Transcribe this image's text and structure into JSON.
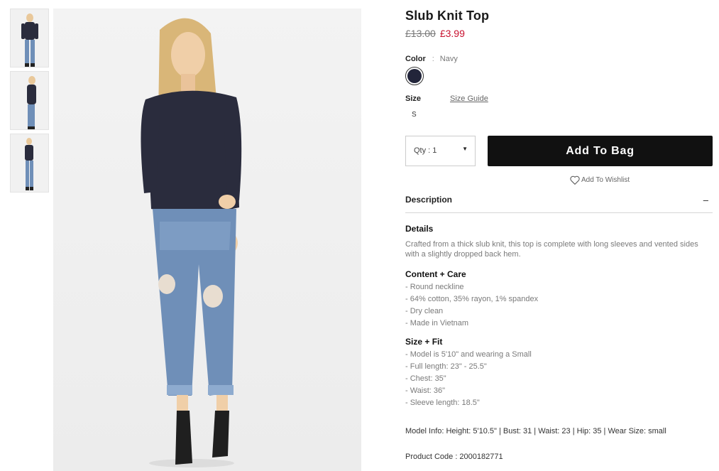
{
  "product": {
    "title": "Slub Knit Top",
    "price_original": "£13.00",
    "price_sale": "£3.99"
  },
  "color": {
    "label": "Color",
    "separator": ":",
    "value": "Navy",
    "swatch_hex": "#22253a"
  },
  "size": {
    "label": "Size",
    "guide_label": "Size Guide",
    "options": [
      "S"
    ]
  },
  "qty": {
    "label": "Qty : 1"
  },
  "actions": {
    "add_to_bag": "Add To Bag",
    "wishlist": "Add To Wishlist"
  },
  "description": {
    "header": "Description",
    "toggle": "–",
    "details_title": "Details",
    "details_text": "Crafted from a thick slub knit, this top is complete with long sleeves and vented sides with a slightly dropped back hem.",
    "content_title": "Content + Care",
    "content_items": [
      "- Round neckline",
      "- 64% cotton, 35% rayon, 1% spandex",
      "- Dry clean",
      "- Made in Vietnam"
    ],
    "fit_title": "Size + Fit",
    "fit_items": [
      "- Model is 5'10\" and wearing a Small",
      "- Full length: 23\" - 25.5\"",
      "- Chest: 35\"",
      "- Waist: 36\"",
      "- Sleeve length: 18.5\""
    ],
    "model_info": "Model Info: Height: 5'10.5\" | Bust: 31 | Waist: 23 | Hip: 35 | Wear Size: small",
    "product_code": "Product Code : 2000182771"
  },
  "colors": {
    "accent_sale": "#c8102e",
    "button_bg": "#111111",
    "top_garment": "#2a2c3d",
    "jeans": "#6f8fb8"
  }
}
